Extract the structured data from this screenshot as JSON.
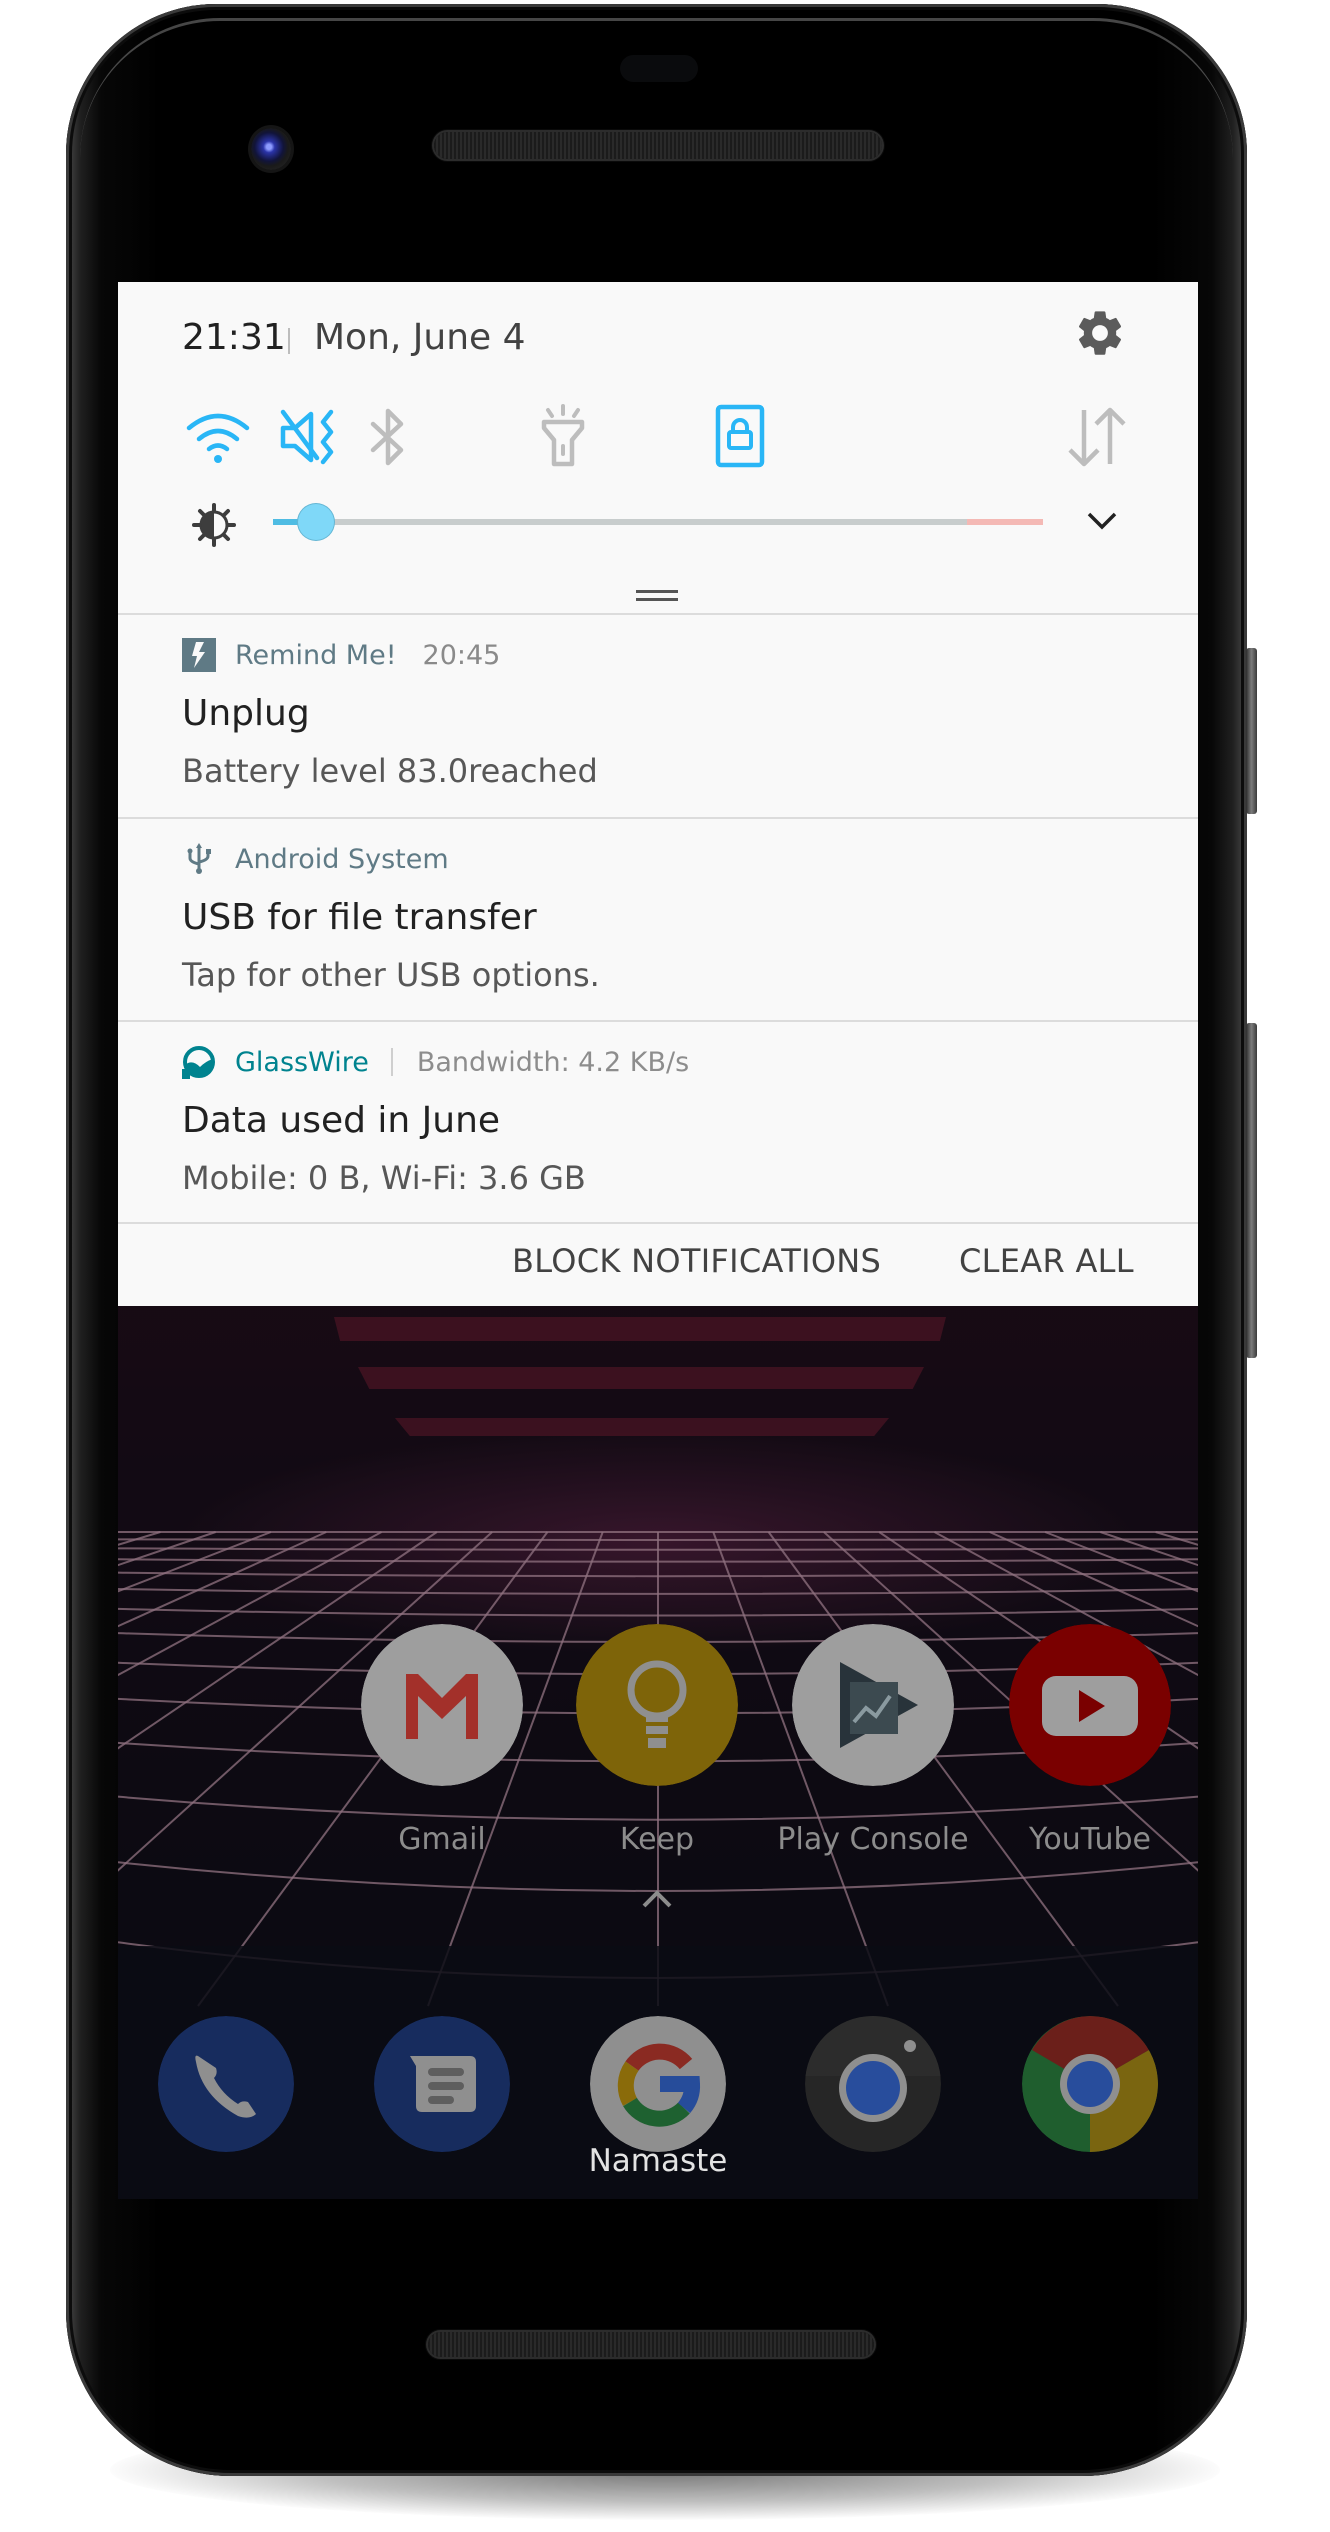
{
  "status": {
    "time": "21:31",
    "date": "Mon, June 4"
  },
  "quick_settings": {
    "tiles": [
      {
        "name": "Wi-Fi",
        "icon": "wifi-icon",
        "active": true
      },
      {
        "name": "Sound",
        "icon": "vibrate-mute-icon",
        "active": true
      },
      {
        "name": "Bluetooth",
        "icon": "bluetooth-icon",
        "active": false
      },
      {
        "name": "Flashlight",
        "icon": "flashlight-icon",
        "active": false
      },
      {
        "name": "Screen rotation lock",
        "icon": "rotation-lock-icon",
        "active": true
      },
      {
        "name": "Mobile data",
        "icon": "mobile-data-icon",
        "active": false
      }
    ],
    "brightness": {
      "value_percent": 5.6,
      "warning_from_percent": 90
    },
    "settings_icon": "gear-icon",
    "expand_icon": "chevron-down-icon"
  },
  "colors": {
    "accent": "#29b6f6",
    "inactive": "#bdbdbd",
    "glasswire": "#00838f",
    "app_name": "#5f7a85"
  },
  "notifications": [
    {
      "app": "Remind Me!",
      "app_icon": "lightning-bolt-icon",
      "time": "20:45",
      "title": "Unplug",
      "body": "Battery level 83.0reached"
    },
    {
      "app": "Android System",
      "app_icon": "usb-icon",
      "title": "USB for file transfer",
      "body": "Tap for other USB options."
    },
    {
      "app": "GlassWire",
      "app_icon": "glasswire-icon",
      "extra": "Bandwidth: 4.2 KB/s",
      "title": "Data used in June",
      "body": "Mobile: 0 B, Wi-Fi: 3.6 GB"
    }
  ],
  "panel_actions": {
    "block": "BLOCK NOTIFICATIONS",
    "clear": "CLEAR ALL"
  },
  "home": {
    "apps": [
      {
        "label": "Gmail",
        "icon": "gmail-icon"
      },
      {
        "label": "Keep",
        "icon": "keep-icon"
      },
      {
        "label": "Play Console",
        "icon": "play-console-icon"
      },
      {
        "label": "YouTube",
        "icon": "youtube-icon"
      }
    ],
    "dock": [
      {
        "name": "Phone",
        "icon": "phone-icon"
      },
      {
        "name": "Messages",
        "icon": "messages-icon"
      },
      {
        "name": "Google",
        "icon": "google-icon"
      },
      {
        "name": "Camera",
        "icon": "camera-icon"
      },
      {
        "name": "Chrome",
        "icon": "chrome-icon"
      }
    ],
    "dock_label": "Namaste",
    "drawer_icon": "chevron-up-icon"
  }
}
